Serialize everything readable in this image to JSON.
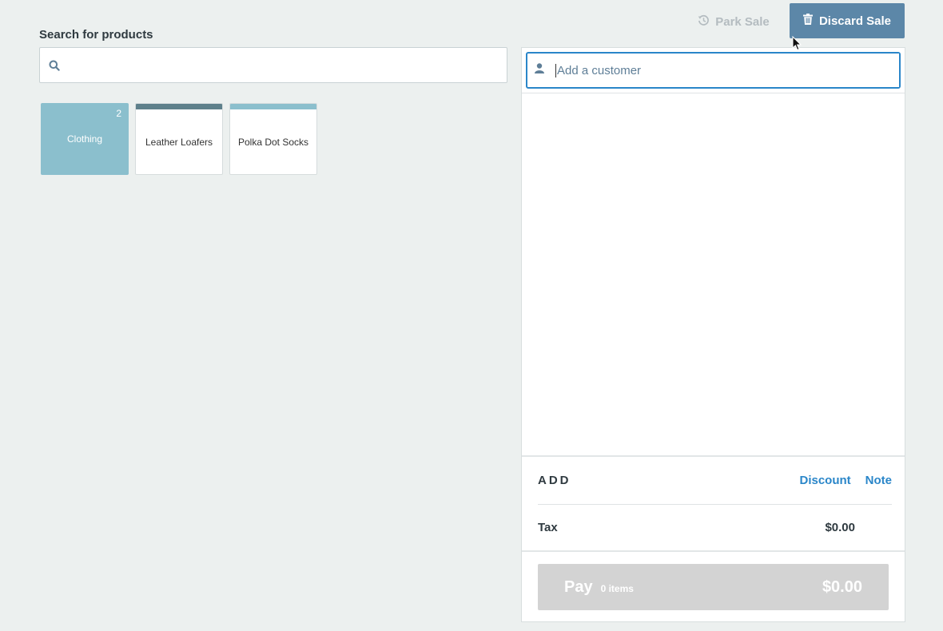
{
  "search": {
    "label": "Search for products",
    "value": "",
    "placeholder": "",
    "icon": "search-icon"
  },
  "tiles": [
    {
      "name": "Clothing",
      "type": "category",
      "count": "2",
      "color": "#8bbfcd"
    },
    {
      "name": "Leather Loafers",
      "type": "product",
      "color": "#5e808b"
    },
    {
      "name": "Polka Dot Socks",
      "type": "product",
      "color": "#8bbfcd"
    }
  ],
  "actions": {
    "park_sale": "Park Sale",
    "park_icon": "history-icon",
    "discard_sale": "Discard Sale",
    "discard_icon": "trash-icon"
  },
  "customer": {
    "placeholder": "Add a customer",
    "value": "",
    "icon": "user-icon"
  },
  "add": {
    "title": "ADD",
    "discount": "Discount",
    "note": "Note"
  },
  "tax": {
    "label": "Tax",
    "value": "$0.00"
  },
  "pay": {
    "label": "Pay",
    "items": "0 items",
    "amount": "$0.00"
  },
  "colors": {
    "background": "#ecf0ef",
    "accent": "#2a86c9",
    "discard_button": "#5c87a8",
    "pay_disabled": "#d3d3d3"
  }
}
